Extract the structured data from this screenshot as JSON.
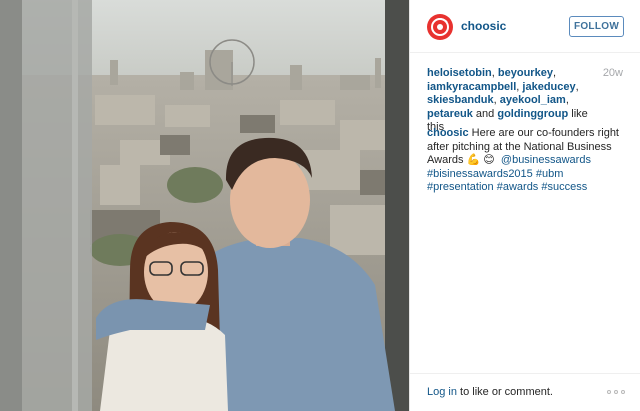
{
  "post": {
    "username": "choosic",
    "follow_label": "FOLLOW",
    "age": "20w",
    "likers": [
      "heloisetobin",
      "beyourkey",
      "iamkyracampbell",
      "jakeducey",
      "skiesbanduk",
      "ayekool_iam",
      "petareuk",
      "goldinggroup"
    ],
    "likes_connector": "and",
    "likes_suffix": "like this",
    "caption_user": "choosic",
    "caption_text": "Here are our co-founders right after pitching at the National Business Awards",
    "caption_emoji": "💪 😊",
    "mention": "@businessawards",
    "hashtags": [
      "#bisinessawards2015",
      "#ubm",
      "#presentation",
      "#awards",
      "#success"
    ],
    "login_link": "Log in",
    "login_suffix": "to like or comment."
  },
  "icons": {
    "avatar": "choosic-logo-icon",
    "more": "more-options-icon"
  },
  "colors": {
    "link": "#125688",
    "follow_border": "#5b8bbd",
    "brand_red": "#e8322f",
    "muted": "#a5a7aa"
  }
}
